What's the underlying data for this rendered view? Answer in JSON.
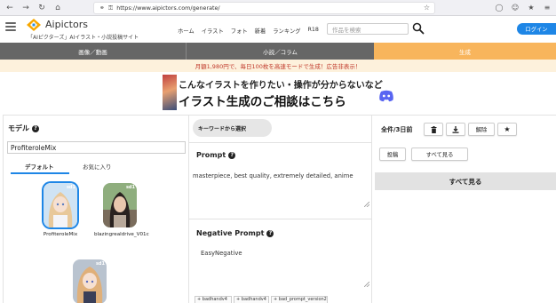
{
  "browser": {
    "url": "https://www.aipictors.com/generate/"
  },
  "header": {
    "brand": "Aipictors",
    "tagline": "「AIピクターズ」AIイラスト・小説投稿サイト",
    "nav": [
      "ホーム",
      "イラスト",
      "フォト",
      "新着",
      "ランキング",
      "R18"
    ],
    "search_placeholder": "作品を検索",
    "login_label": "ログイン",
    "accent_color": "#1e86e6"
  },
  "mode_tabs": [
    {
      "label": "画像／動画",
      "active": false
    },
    {
      "label": "小説／コラム",
      "active": false
    },
    {
      "label": "生成",
      "active": true
    }
  ],
  "promo_text": "月額1,980円で、毎日100枚を高速モードで生成！広告非表示！",
  "banner": {
    "line1": "こんなイラストを作りたい・操作が分からないなど",
    "line2": "イラスト生成のご相談はこちら"
  },
  "model_panel": {
    "title": "モデル",
    "selected_model": "ProfiteroleMix",
    "tabs": [
      "デフォルト",
      "お気に入り"
    ],
    "items": [
      {
        "caption": "ProfiteroleMix",
        "badge": "sd1",
        "selected": true
      },
      {
        "caption": "blazingrealdrive_V01c",
        "badge": "sd1",
        "selected": false
      },
      {
        "caption": "",
        "badge": "sd1",
        "selected": false
      }
    ]
  },
  "prompt_panel": {
    "keyword_button": "キーワードから選択",
    "prompt_title": "Prompt",
    "prompt_value": "masterpiece, best quality, extremely detailed, anime",
    "negative_title": "Negative Prompt",
    "negative_value": "EasyNegative",
    "negative_tags": [
      "+ badhandv4",
      "+ badhandv4",
      "+ bad_prompt_version2"
    ]
  },
  "history_panel": {
    "label": "全件/3日前",
    "buttons": {
      "trash": "trash-icon",
      "download": "download-icon",
      "cancel": "解除",
      "favorite": "star-icon",
      "post": "投稿",
      "show_all": "すべて見る"
    },
    "show_all_big": "すべて見る"
  }
}
